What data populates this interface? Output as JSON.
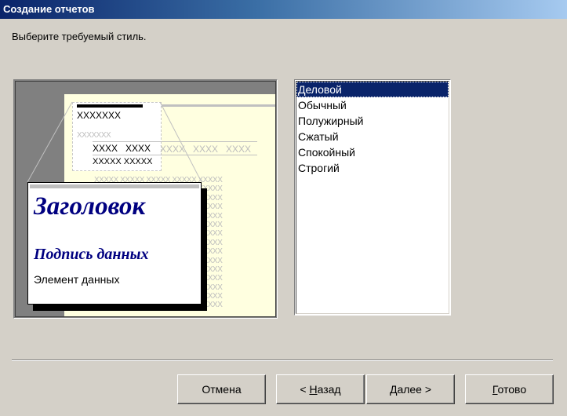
{
  "window": {
    "title": "Создание отчетов"
  },
  "instruction": "Выберите требуемый стиль.",
  "preview": {
    "header_sample": "XXXXXXX",
    "group_sample": "XXXXXXX",
    "col_headers": [
      "XXXX",
      "XXXX"
    ],
    "col_headers_faded": [
      "XXXX",
      "XXXX",
      "XXXX"
    ],
    "row_sample": "XXXXX  XXXXX",
    "row_faded": "XXXXX XXXXX XXXXX XXXXX XXXXX",
    "heading": "Заголовок",
    "data_caption": "Подпись данных",
    "data_element": "Элемент данных"
  },
  "styles": {
    "items": [
      "Деловой",
      "Обычный",
      "Полужирный",
      "Сжатый",
      "Спокойный",
      "Строгий"
    ],
    "selected": "Деловой"
  },
  "buttons": {
    "cancel": "Отмена",
    "back_prefix": "< ",
    "back_mnemonic": "Н",
    "back_rest": "азад",
    "next_mnemonic": "Д",
    "next_rest": "алее >",
    "finish_mnemonic": "Г",
    "finish_rest": "отово"
  },
  "colors": {
    "title_gradient_start": "#0a246a",
    "title_gradient_end": "#a6caf0",
    "preview_heading": "#000080",
    "preview_page": "#ffffe0",
    "selection": "#0a246a",
    "dialog_bg": "#d4d0c8"
  }
}
